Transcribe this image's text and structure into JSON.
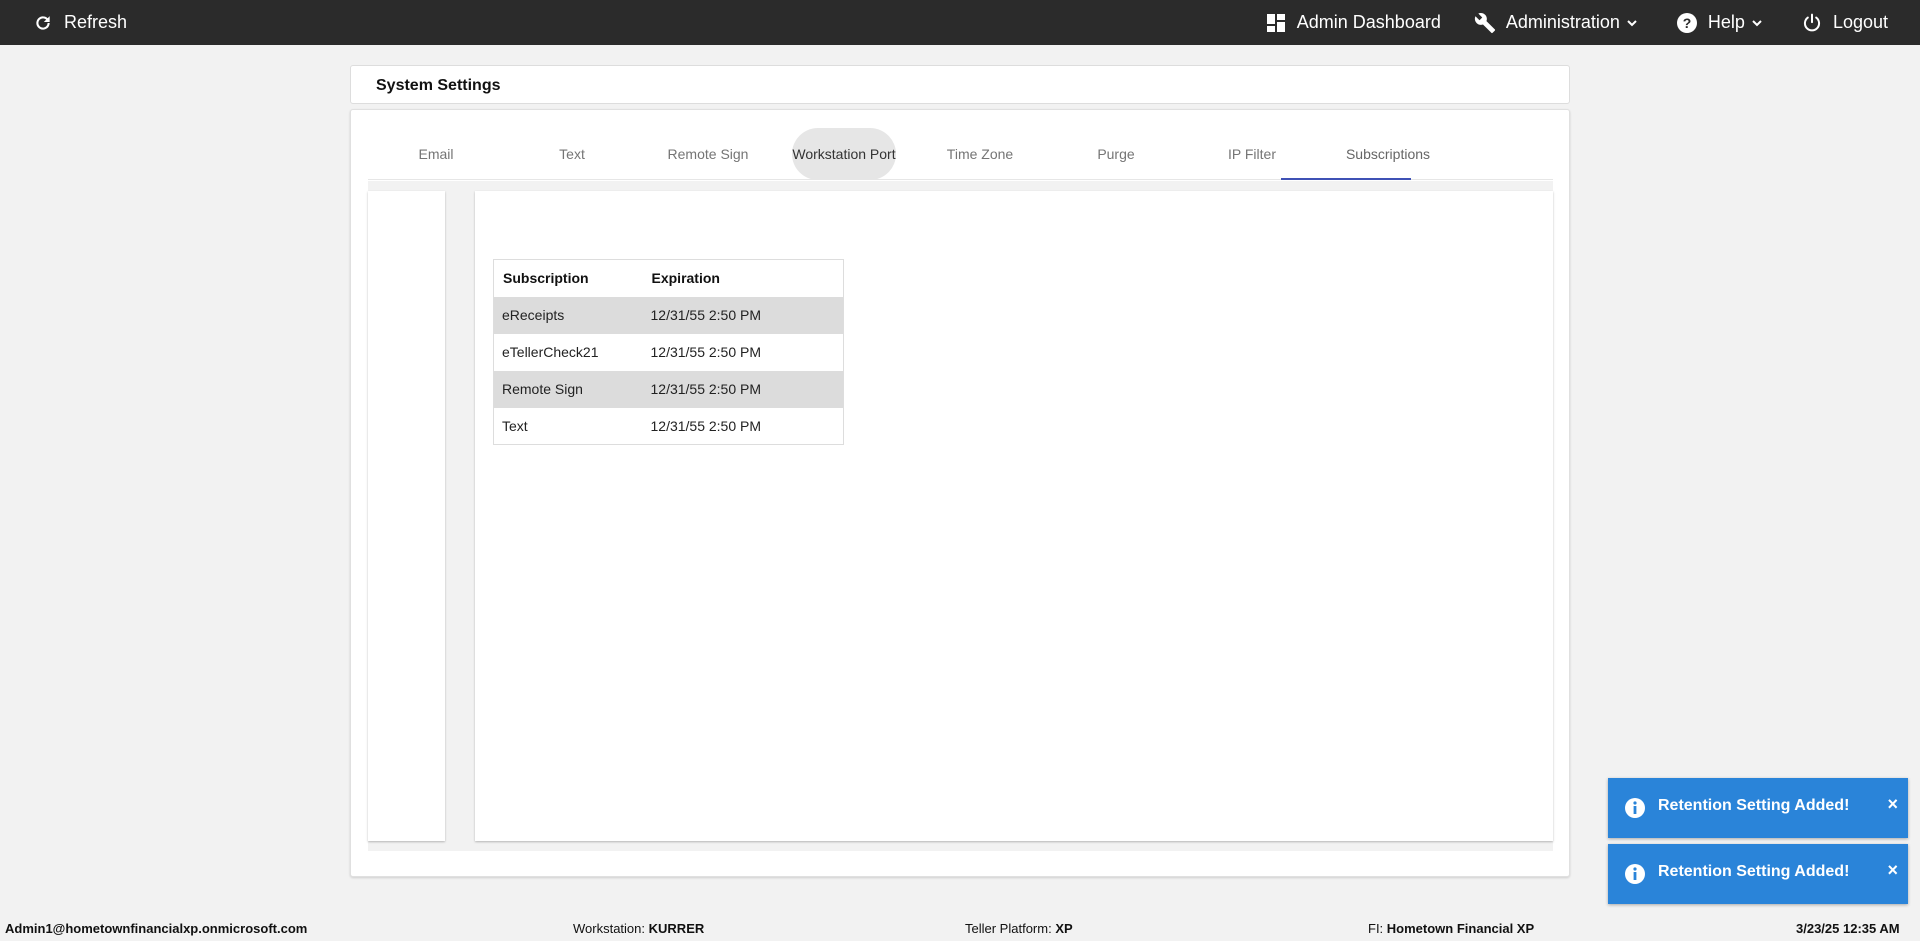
{
  "topbar": {
    "refresh": "Refresh",
    "admin_dashboard": "Admin Dashboard",
    "administration": "Administration",
    "help": "Help",
    "logout": "Logout"
  },
  "page": {
    "title": "System Settings"
  },
  "tabs": [
    {
      "label": "Email"
    },
    {
      "label": "Text"
    },
    {
      "label": "Remote Sign"
    },
    {
      "label": "Workstation Port"
    },
    {
      "label": "Time Zone"
    },
    {
      "label": "Purge"
    },
    {
      "label": "IP Filter"
    },
    {
      "label": "Subscriptions"
    }
  ],
  "active_tab": "Subscriptions",
  "subscriptions_table": {
    "headers": [
      "Subscription",
      "Expiration"
    ],
    "rows": [
      [
        "eReceipts",
        "12/31/55 2:50 PM"
      ],
      [
        "eTellerCheck21",
        "12/31/55 2:50 PM"
      ],
      [
        "Remote Sign",
        "12/31/55 2:50 PM"
      ],
      [
        "Text",
        "12/31/55 2:50 PM"
      ]
    ]
  },
  "toasts": [
    {
      "message": "Retention Setting Added!",
      "close": "×"
    },
    {
      "message": "Retention Setting Added!",
      "close": "×"
    }
  ],
  "statusbar": {
    "user": "Admin1@hometownfinancialxp.onmicrosoft.com",
    "workstation_label": "Workstation:",
    "workstation_value": "KURRER",
    "platform_label": "Teller Platform:",
    "platform_value": "XP",
    "fi_label": "FI:",
    "fi_value": "Hometown Financial XP",
    "datetime": "3/23/25 12:35 AM"
  },
  "colors": {
    "topbar": "#2b2b2b",
    "tab_indicator": "#3f51b5",
    "toast": "#2a84d9"
  }
}
